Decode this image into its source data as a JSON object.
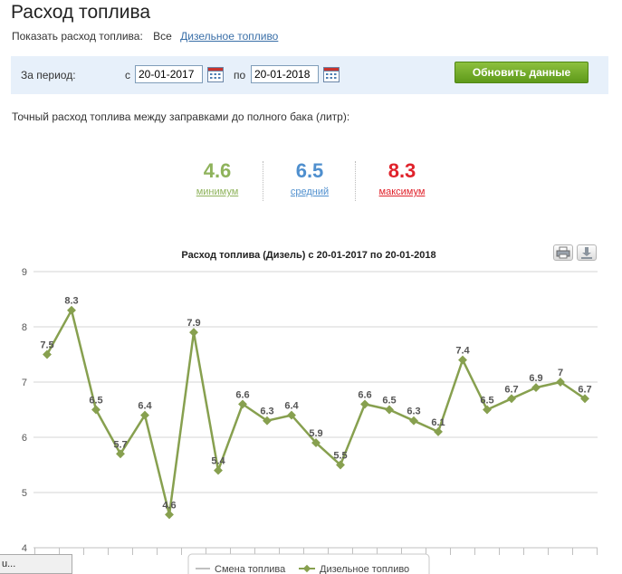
{
  "page": {
    "title": "Расход топлива",
    "filter_label": "Показать расход топлива:",
    "filter_all": "Все",
    "filter_diesel": "Дизельное топливо"
  },
  "period": {
    "label": "За период:",
    "from_label": "с",
    "from_value": "20-01-2017",
    "to_label": "по",
    "to_value": "20-01-2018",
    "refresh_button": "Обновить данные"
  },
  "description": "Точный расход топлива между заправками до полного бака (литр):",
  "stats": {
    "min_value": "4.6",
    "min_label": "минимум",
    "avg_value": "6.5",
    "avg_label": "средний",
    "max_value": "8.3",
    "max_label": "максимум"
  },
  "status_text": "u...",
  "colors": {
    "series": "#87a04f",
    "min": "#8fb35c",
    "avg": "#4f8fce",
    "max": "#e0222b",
    "refresh_button": "#6fa82a"
  },
  "icons": {
    "calendar": "calendar-icon",
    "print": "print-icon",
    "export": "download-icon"
  },
  "chart_data": {
    "type": "line",
    "title": "Расход топлива (Дизель) с 20-01-2017 по 20-01-2018",
    "xlabel": "",
    "ylabel": "",
    "ylim": [
      4,
      9
    ],
    "yticks": [
      "4",
      "5",
      "6",
      "7",
      "8",
      "9"
    ],
    "grid": true,
    "legend_position": "bottom",
    "legend": [
      "Смена топлива",
      "Дизельное топливо"
    ],
    "series": [
      {
        "name": "Дизельное топливо",
        "values": [
          7.5,
          8.3,
          6.5,
          5.7,
          6.4,
          4.6,
          7.9,
          5.4,
          6.6,
          6.3,
          6.4,
          5.9,
          5.5,
          6.6,
          6.5,
          6.3,
          6.1,
          7.4,
          6.5,
          6.7,
          6.9,
          7,
          6.7
        ],
        "labels": [
          "7.5",
          "8.3",
          "6.5",
          "5.7",
          "6.4",
          "4.6",
          "7.9",
          "5.4",
          "6.6",
          "6.3",
          "6.4",
          "5.9",
          "5.5",
          "6.6",
          "6.5",
          "6.3",
          "6.1",
          "7.4",
          "6.5",
          "6.7",
          "6.9",
          "7",
          "6.7"
        ]
      }
    ]
  }
}
